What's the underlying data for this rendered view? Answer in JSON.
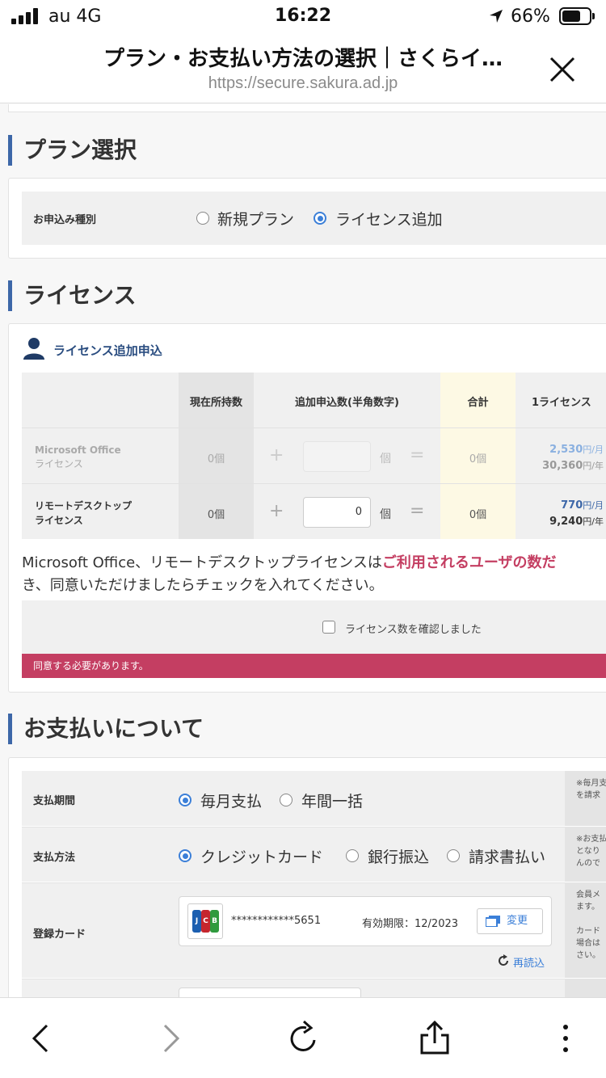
{
  "status_bar": {
    "carrier": "au  4G",
    "time": "16:22",
    "battery": "66%"
  },
  "browser": {
    "title": "プラン・お支払い方法の選択｜さくらイ…",
    "url": "https://secure.sakura.ad.jp"
  },
  "plan_section": {
    "title": "プラン選択",
    "application_type_label": "お申込み種別",
    "options": [
      {
        "label": "新規プラン",
        "selected": false
      },
      {
        "label": "ライセンス追加",
        "selected": true
      }
    ]
  },
  "license_section": {
    "title": "ライセンス",
    "subtitle": "ライセンス追加申込",
    "table": {
      "headers": [
        "現在所持数",
        "追加申込数(半角数字)",
        "合計",
        "1ライセンス"
      ],
      "rows": [
        {
          "name_line1": "Microsoft Office",
          "name_line2": "ライセンス",
          "current": "0個",
          "add_value": "",
          "unit": "個",
          "total": "0個",
          "price_month": "2,530",
          "month_unit": "円/月",
          "price_year": "30,360",
          "year_unit": "円/年",
          "disabled": true
        },
        {
          "name_line1": "リモートデスクトップ",
          "name_line2": "ライセンス",
          "current": "0個",
          "add_value": "0",
          "unit": "個",
          "total": "0個",
          "price_month": "770",
          "month_unit": "円/月",
          "price_year": "9,240",
          "year_unit": "円/年",
          "disabled": false
        }
      ]
    },
    "notice_line1_prefix": "Microsoft Office、リモートデスクトップライセンスは",
    "notice_line1_emphasis": "ご利用されるユーザの数だ",
    "notice_line2": "き、同意いただけましたらチェックを入れてください。",
    "confirm_label": "ライセンス数を確認しました",
    "error_message": "同意する必要があります。"
  },
  "payment_section": {
    "title": "お支払いについて",
    "period": {
      "label": "支払期間",
      "options": [
        {
          "label": "毎月支払",
          "selected": true
        },
        {
          "label": "年間一括",
          "selected": false
        }
      ],
      "note_lines": [
        "※毎月支",
        "を請求"
      ]
    },
    "method": {
      "label": "支払方法",
      "options": [
        {
          "label": "クレジットカード",
          "selected": true
        },
        {
          "label": "銀行振込",
          "selected": false
        },
        {
          "label": "請求書払い",
          "selected": false
        }
      ],
      "note_lines": [
        "※お支払",
        "となり",
        "んので"
      ]
    },
    "card": {
      "label": "登録カード",
      "brand": "JCB",
      "number": "************5651",
      "expiry": "有効期限：12/2023",
      "change_label": "変更",
      "reload_label": "再読込",
      "note_lines": [
        "会員メ",
        "ます。",
        "",
        "カード",
        "場合は",
        "さい。"
      ]
    }
  },
  "colors": {
    "accent_blue": "#3b7fd8",
    "section_bar": "#3d67a8",
    "error_red": "#c43e62",
    "header_gray": "#f0f0f0",
    "total_yellow": "#fdf9e4"
  },
  "icons": [
    "signal-icon",
    "location-arrow-icon",
    "battery-icon",
    "close-icon",
    "user-icon",
    "card-edit-icon",
    "reload-icon",
    "back-icon",
    "forward-icon",
    "refresh-icon",
    "share-icon",
    "more-icon"
  ]
}
